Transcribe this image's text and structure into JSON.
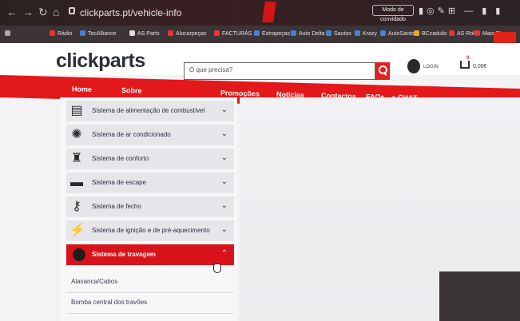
{
  "browser": {
    "url": "clickparts.pt/vehicle-info",
    "mode_button": "Modo de convidado",
    "bookmarks": [
      "Rádio",
      "TecAlliance",
      "AS Parts",
      "Alocarpeças",
      "FACTURÁS",
      "Extrapeças",
      "Auto Delta",
      "Sautos",
      "Krazy",
      "AutoSanto",
      "BCcadulis",
      "AS Rola",
      "Mais Plus"
    ]
  },
  "site": {
    "logo": "clickparts",
    "search_placeholder": "O que precisa?",
    "login_label": "LOGIN",
    "cart_count": "0",
    "cart_total": "0,00€"
  },
  "nav": {
    "items": [
      "Home",
      "Sobre",
      "Promoções",
      "Notícias",
      "Contactos",
      "FAQs",
      "CHAT"
    ]
  },
  "menu": {
    "categories": [
      {
        "label": "Sistema de alimentação de combustível",
        "icon": "fuel-pump-icon"
      },
      {
        "label": "Sistema de ar condicionado",
        "icon": "fan-icon"
      },
      {
        "label": "Sistema de conforto",
        "icon": "seat-icon"
      },
      {
        "label": "Sistema de escape",
        "icon": "exhaust-icon"
      },
      {
        "label": "Sistema de fecho",
        "icon": "key-icon"
      },
      {
        "label": "Sistema de ignição e de pré-aquecimento",
        "icon": "spark-plug-icon"
      },
      {
        "label": "Sistema de travagem",
        "icon": "brake-disc-icon"
      }
    ],
    "subitems": [
      "Alavanca/Cabos",
      "Bomba central dos travões"
    ]
  },
  "colors": {
    "brand_red": "#e2181b",
    "logo_dark": "#2c2f36"
  }
}
